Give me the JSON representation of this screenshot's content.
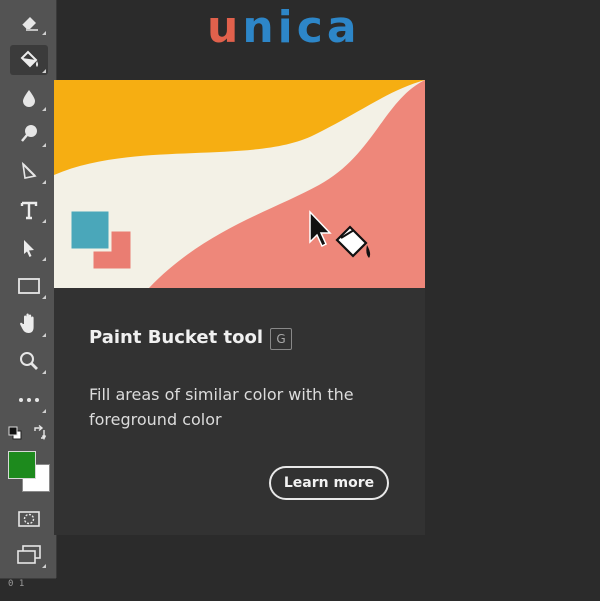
{
  "logo": {
    "first_letter": "u",
    "rest": "nica"
  },
  "tooltip": {
    "title": "Paint Bucket tool",
    "shortcut": "G",
    "description": "Fill areas of similar color with the foreground color",
    "learn_more_label": "Learn more"
  },
  "toolbar": {
    "tools": [
      {
        "name": "eraser-icon"
      },
      {
        "name": "paint-bucket-icon",
        "active": true
      },
      {
        "name": "blur-drop-icon"
      },
      {
        "name": "dodge-icon"
      },
      {
        "name": "pen-icon"
      },
      {
        "name": "type-icon"
      },
      {
        "name": "path-selection-icon"
      },
      {
        "name": "rectangle-icon"
      },
      {
        "name": "hand-icon"
      },
      {
        "name": "zoom-icon"
      },
      {
        "name": "more-tools-icon"
      }
    ],
    "foreground_color": "#1d8a1d",
    "background_color": "#ffffff"
  },
  "ruler": {
    "label": "0 1"
  },
  "colors": {
    "illustration_yellow": "#f6ae12",
    "illustration_cream": "#f3f1e6",
    "illustration_salmon": "#ee877a",
    "square_teal": "#4aa7ba",
    "square_salmon": "#ea7d72"
  }
}
